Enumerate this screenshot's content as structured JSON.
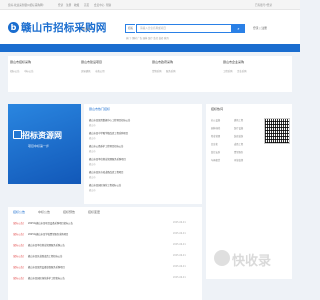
{
  "topbar": {
    "left": "您好,欢迎来到赣州招标采购网!",
    "links": [
      "登录",
      "注册",
      "收藏",
      "首页",
      "会员中心",
      "帮助"
    ],
    "right": "已有账号?登录"
  },
  "header": {
    "logo_glyph": "b",
    "site_title": "赣山市招标采购网",
    "region": "赣山市",
    "search_tab": "招标",
    "search_placeholder": "请输入企业名称或项目",
    "search_icon": "search-icon",
    "hotwords": "热门: 钢材  广告  园林  医疗  监控  装修  家具",
    "login": "登录",
    "register": "注册"
  },
  "categories": [
    {
      "title": "赣山市招标采购",
      "subs": [
        "招标公告",
        "中标公告"
      ]
    },
    {
      "title": "赣山市建设项目",
      "subs": [
        "房屋建筑",
        "市政公用"
      ]
    },
    {
      "title": "赣山市政府采购",
      "subs": [
        "货物采购",
        "服务采购"
      ]
    },
    {
      "title": "赣山市企业采购",
      "subs": [
        "工程采购",
        "企业采购"
      ]
    }
  ],
  "banner": {
    "title": "招标资源网",
    "subtitle": "项目中标第一步"
  },
  "mid": {
    "tab_active": "赣山市热门招标",
    "rows": [
      {
        "title": "赣山市某医院数据中心工程项目招标公告",
        "meta": "赣山市"
      },
      {
        "title": "赣山市某中学教学楼改造工程采购项目",
        "meta": "赣山市"
      },
      {
        "title": "赣山市公路养护工程项目招标公告",
        "meta": "赣山市"
      },
      {
        "title": "赣山市某单位物业管理服务采购项目",
        "meta": "赣山市"
      },
      {
        "title": "赣山市某区市政道路改造工程项目",
        "meta": "赣山市"
      },
      {
        "title": "赣山市某园区绿化工程招标公告",
        "meta": "赣山市"
      }
    ]
  },
  "right": {
    "title": "招标热词",
    "tags": [
      "办公设备",
      "建筑工程",
      "园林绿化",
      "医疗设备",
      "物业管理",
      "装修装饰",
      "信息化",
      "道路工程",
      "监控安防",
      "食堂服务",
      "车辆租赁",
      "环境监测"
    ]
  },
  "bottom": {
    "tabs": [
      "招标公告",
      "中标公告",
      "招标预告",
      "招标变更"
    ],
    "rows": [
      {
        "tag": "[招标公告]",
        "title": "2025年赣山市某项目设备采购项目招标公告",
        "region": "赣山市",
        "date": "2025-06-01"
      },
      {
        "tag": "[招标公告]",
        "title": "2025年赣山市某学校食堂服务采购项目",
        "region": "赣山市",
        "date": "2025-06-01"
      },
      {
        "tag": "[招标公告]",
        "title": "赣山市某单位物业管理服务采购公告",
        "region": "赣山市",
        "date": "2025-06-01"
      },
      {
        "tag": "[招标公告]",
        "title": "赣山市某区道路改造工程招标公告",
        "region": "赣山市",
        "date": "2025-06-01"
      },
      {
        "tag": "[招标公告]",
        "title": "赣山市某医院设备维保服务采购项目",
        "region": "赣山市",
        "date": "2025-06-01"
      },
      {
        "tag": "[招标公告]",
        "title": "赣山市某园区绿化养护工程招标公告",
        "region": "赣山市",
        "date": "2025-06-01"
      }
    ]
  },
  "watermark": "快收录"
}
